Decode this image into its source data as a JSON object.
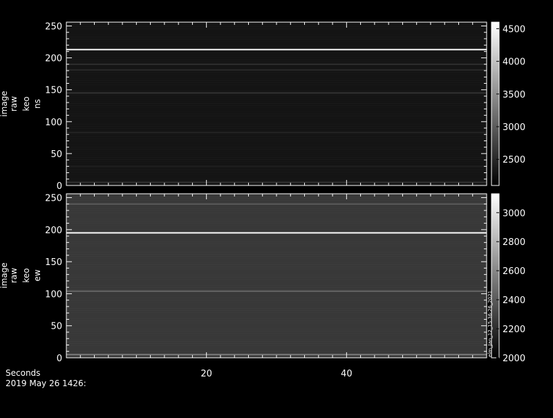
{
  "chart_data": [
    {
      "type": "heatmap",
      "panel": "top",
      "ylabel_lines": [
        "image",
        "raw",
        "keo",
        "ns"
      ],
      "y_ticks": [
        0,
        50,
        100,
        150,
        200,
        250
      ],
      "ylim": [
        0,
        256
      ],
      "x_ticks": [
        20,
        40
      ],
      "xlim": [
        0,
        60
      ],
      "colorbar": {
        "ticks": [
          2500,
          3000,
          3500,
          4000,
          4500
        ],
        "range": [
          2100,
          4600
        ]
      },
      "bright_rows": [
        {
          "y": 213,
          "level": 4600
        },
        {
          "y": 190,
          "level": 2550
        },
        {
          "y": 181,
          "level": 2500
        },
        {
          "y": 145,
          "level": 2600
        },
        {
          "y": 83,
          "level": 2450
        },
        {
          "y": 30,
          "level": 2400
        },
        {
          "y": 5,
          "level": 2600
        }
      ],
      "background_level": 2300
    },
    {
      "type": "heatmap",
      "panel": "bottom",
      "ylabel_lines": [
        "image",
        "raw",
        "keo",
        "ew"
      ],
      "y_ticks": [
        0,
        50,
        100,
        150,
        200,
        250
      ],
      "ylim": [
        0,
        256
      ],
      "x_ticks": [
        20,
        40
      ],
      "xlim": [
        0,
        60
      ],
      "colorbar": {
        "ticks": [
          2000,
          2200,
          2400,
          2600,
          2800,
          3000
        ],
        "range": [
          2000,
          3130
        ]
      },
      "bright_rows": [
        {
          "y": 195,
          "level": 3130
        },
        {
          "y": 240,
          "level": 2400
        },
        {
          "y": 104,
          "level": 2450
        },
        {
          "y": 5,
          "level": 2550
        }
      ],
      "background_level": 2250
    }
  ],
  "footer": {
    "xlabel": "Seconds",
    "date": "2019 May 26 1426:"
  },
  "side_note": "elm_Jan_12_15:36:26_2021"
}
